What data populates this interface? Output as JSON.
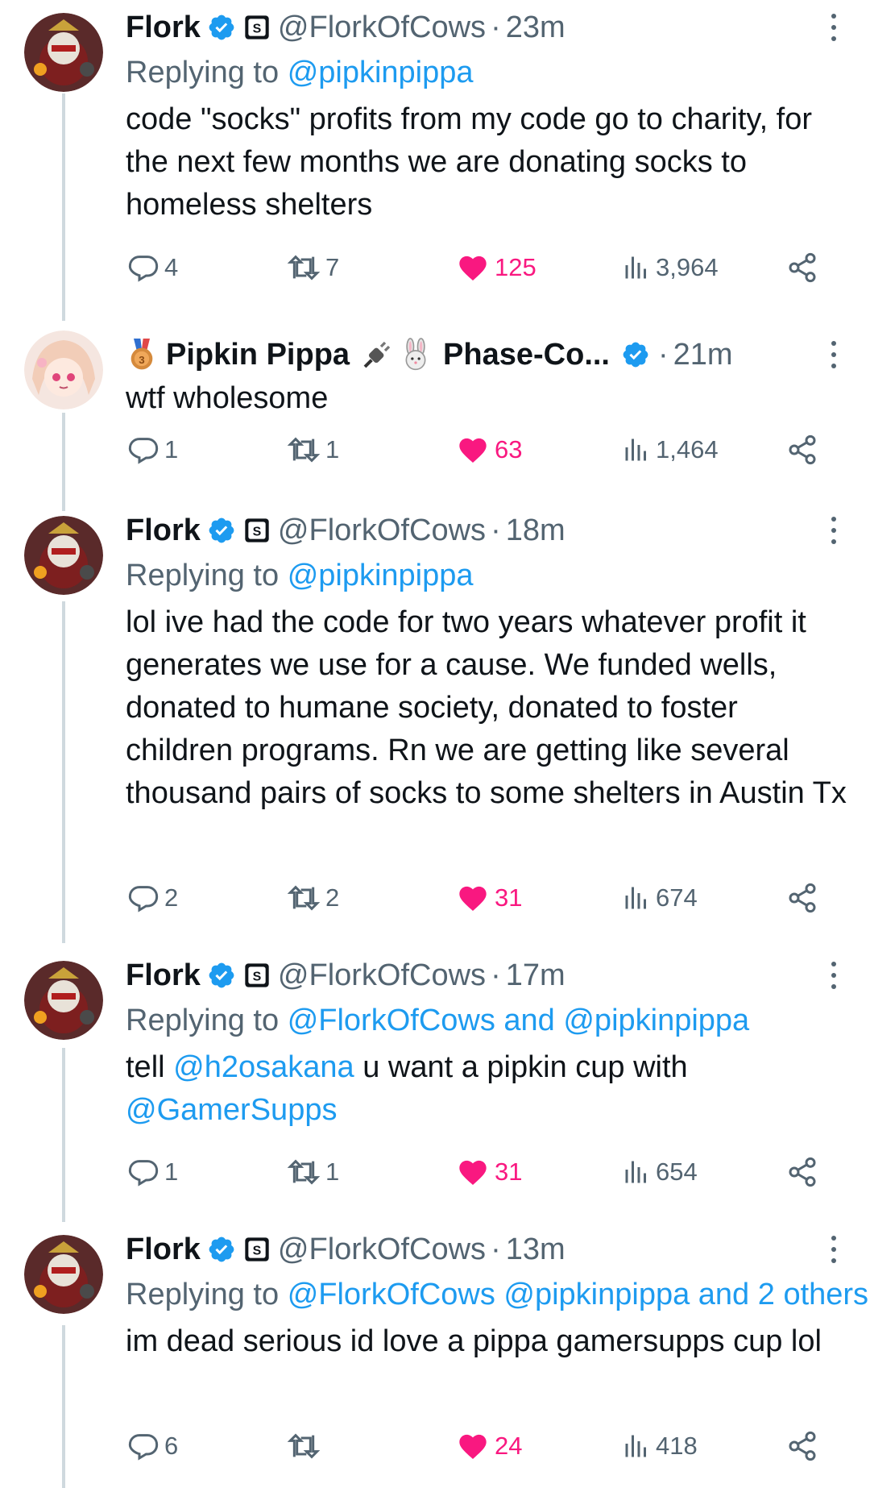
{
  "tweets": [
    {
      "name": "Flork",
      "handle": "@FlorkOfCows",
      "dot": "·",
      "time": "23m",
      "replying_prefix": "Replying to",
      "replying_to": "@pipkinpippa",
      "text": "code \"socks\" profits from my code go to charity, for the next few months we are donating socks to homeless shelters",
      "replies": "4",
      "retweets": "7",
      "likes": "125",
      "views": "3,964"
    },
    {
      "name": "Pipkin Pippa",
      "name_suffix": "Phase-Co...",
      "dot": "·",
      "time": "21m",
      "text": "wtf wholesome",
      "replies": "1",
      "retweets": "1",
      "likes": "63",
      "views": "1,464"
    },
    {
      "name": "Flork",
      "handle": "@FlorkOfCows",
      "dot": "·",
      "time": "18m",
      "replying_prefix": "Replying to",
      "replying_to": "@pipkinpippa",
      "text": "lol ive had the code for two years whatever profit it generates we use for a cause. We funded wells, donated to humane society, donated to foster children programs. Rn we are getting like several thousand pairs of socks to some shelters in Austin Tx",
      "replies": "2",
      "retweets": "2",
      "likes": "31",
      "views": "674"
    },
    {
      "name": "Flork",
      "handle": "@FlorkOfCows",
      "dot": "·",
      "time": "17m",
      "replying_prefix": "Replying to",
      "replying_to": "@FlorkOfCows and @pipkinpippa",
      "text_pre": "tell ",
      "text_mention1": "@h2osakana",
      "text_mid": " u want a pipkin cup with ",
      "text_mention2": "@GamerSupps",
      "replies": "1",
      "retweets": "1",
      "likes": "31",
      "views": "654"
    },
    {
      "name": "Flork",
      "handle": "@FlorkOfCows",
      "dot": "·",
      "time": "13m",
      "replying_prefix": "Replying to",
      "replying_to": "@FlorkOfCows @pipkinpippa and 2 others",
      "text": "im dead serious id love a pippa gamersupps cup lol",
      "replies": "6",
      "retweets": "",
      "likes": "24",
      "views": "418"
    }
  ],
  "colors": {
    "accent": "#1d9bf0",
    "like": "#f91880",
    "muted": "#536471",
    "text": "#0f1419"
  },
  "icons": [
    "reply-icon",
    "retweet-icon",
    "like-icon",
    "views-icon",
    "share-icon",
    "verified-icon",
    "more-icon",
    "medal-icon",
    "plug-icon",
    "rabbit-icon"
  ]
}
